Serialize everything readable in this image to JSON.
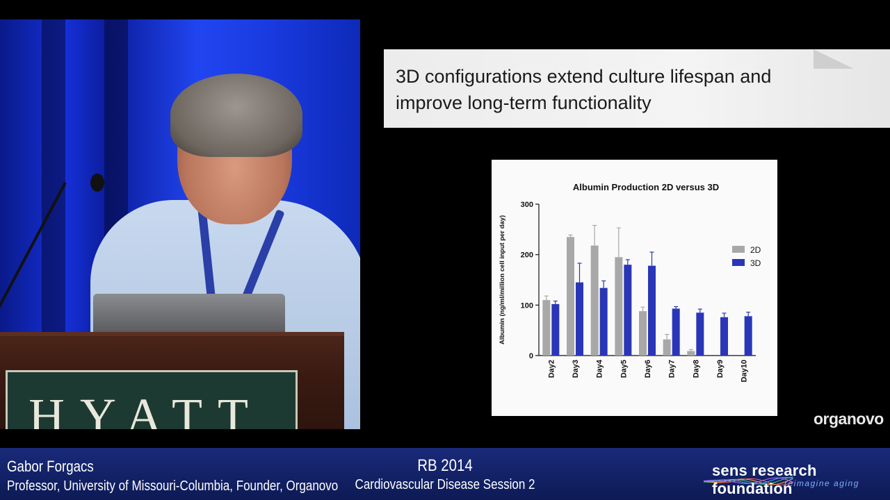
{
  "slide": {
    "title": "3D configurations extend culture lifespan and improve long-term functionality"
  },
  "brand": {
    "logo_text": "organovo"
  },
  "lower_third": {
    "speaker_name": "Gabor Forgacs",
    "speaker_role": "Professor, University of Missouri-Columbia, Founder, Organovo",
    "event_name": "RB 2014",
    "session_name": "Cardiovascular Disease Session 2",
    "org_name": "sens research foundation",
    "org_tagline": "reimagine aging",
    "helix_colors": [
      "#ff5a5a",
      "#ffb23a",
      "#5ad06a",
      "#3ab0ff",
      "#b46aff"
    ]
  },
  "chart_data": {
    "type": "bar",
    "title": "Albumin  Production 2D versus 3D",
    "xlabel": "",
    "ylabel": "Albumin (ng/ml/million cell input per day)",
    "ylim": [
      0,
      300
    ],
    "yticks": [
      "0",
      "100",
      "200",
      "300"
    ],
    "categories": [
      "Day2",
      "Day3",
      "Day4",
      "Day5",
      "Day6",
      "Day7",
      "Day8",
      "Day9",
      "Day10"
    ],
    "series": [
      {
        "name": "2D",
        "color": "#a8a8a8",
        "values": [
          110,
          235,
          218,
          195,
          88,
          32,
          9,
          0,
          0
        ],
        "errors": [
          8,
          4,
          40,
          58,
          8,
          10,
          3,
          0,
          0
        ]
      },
      {
        "name": "3D",
        "color": "#2a36b8",
        "values": [
          102,
          145,
          134,
          180,
          178,
          93,
          85,
          76,
          78
        ],
        "errors": [
          6,
          38,
          14,
          10,
          27,
          4,
          7,
          8,
          8
        ]
      }
    ],
    "legend_position": "right",
    "grid": false
  }
}
